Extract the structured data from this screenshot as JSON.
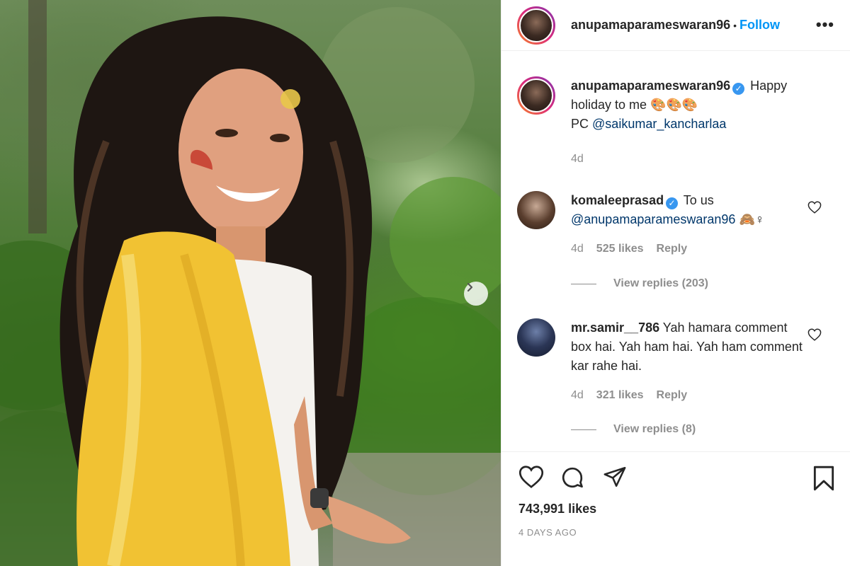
{
  "post": {
    "author": "anupamaparameswaran96",
    "follow_label": "Follow",
    "dot": "•",
    "more_label": "•••"
  },
  "caption": {
    "username": "anupamaparameswaran96",
    "text": "Happy holiday to me 🎨🎨🎨",
    "pc_prefix": "PC",
    "mention": "@saikumar_kancharlaa",
    "time": "4d"
  },
  "comments": [
    {
      "username": "komaleeprasad",
      "verified": true,
      "text": "To us",
      "mention": "@anupamaparameswaran96",
      "emoji": "🙈♀",
      "time": "4d",
      "likes": "525 likes",
      "reply_label": "Reply",
      "view_replies": "View replies (203)"
    },
    {
      "username": "mr.samir__786",
      "verified": false,
      "text": "Yah hamara comment box hai. Yah ham hai. Yah ham comment kar rahe hai.",
      "time": "4d",
      "likes": "321 likes",
      "reply_label": "Reply",
      "view_replies": "View replies (8)"
    }
  ],
  "footer": {
    "likes": "743,991 likes",
    "posted": "4 DAYS AGO"
  },
  "icons": {
    "verified_glyph": "✓",
    "like": "heart-icon",
    "comment": "comment-icon",
    "share": "share-icon",
    "save": "bookmark-icon"
  },
  "colors": {
    "link": "#0095f6",
    "mention": "#00376b",
    "verified": "#3897f0",
    "muted": "#8e8e8e"
  }
}
